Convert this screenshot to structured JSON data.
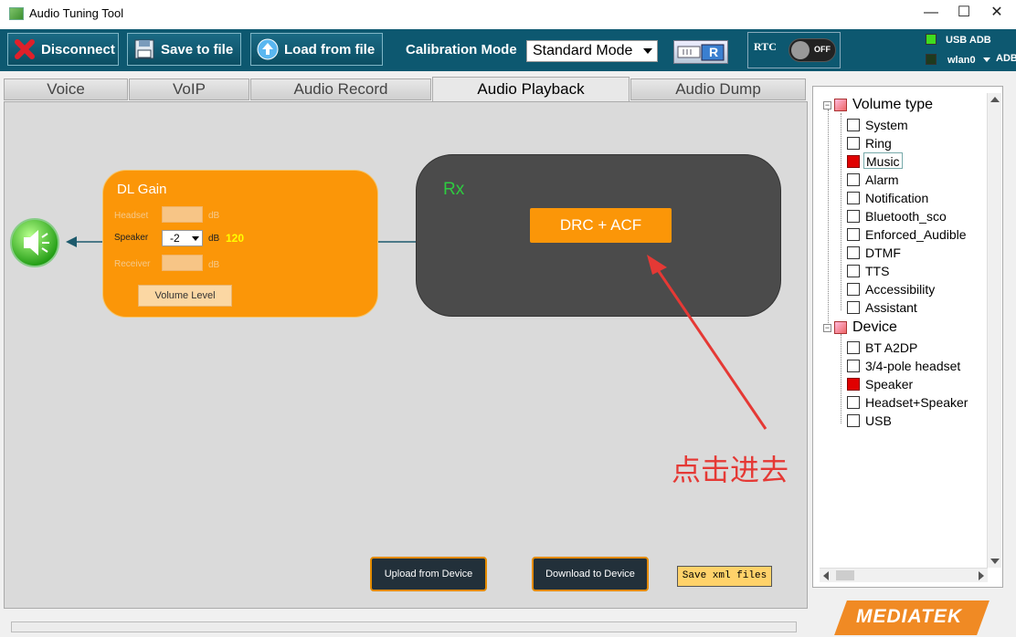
{
  "window": {
    "title": "Audio Tuning Tool",
    "minimize": "—",
    "maximize": "☐",
    "close": "✕"
  },
  "toolbar": {
    "disconnect": "Disconnect",
    "save_to_file": "Save to file",
    "load_from_file": "Load from file",
    "calibration_label": "Calibration Mode",
    "calibration_value": "Standard Mode",
    "r_button": "R",
    "rtc_label": "RTC",
    "rtc_toggle": "OFF",
    "usb_adb": "USB ADB",
    "wlan0": "wlan0",
    "adb": "ADB"
  },
  "tabs": [
    "Voice",
    "VoIP",
    "Audio Record",
    "Audio Playback",
    "Audio Dump"
  ],
  "active_tab": "Audio Playback",
  "dl_gain": {
    "title": "DL Gain",
    "headset_label": "Headset",
    "speaker_label": "Speaker",
    "receiver_label": "Receiver",
    "db": "dB",
    "speaker_value": "-2",
    "speaker_level": "120",
    "volume_level_button": "Volume Level"
  },
  "rx": {
    "title": "Rx",
    "drc_button": "DRC + ACF"
  },
  "annotation": "点击进去",
  "bottom_buttons": {
    "upload": "Upload from Device",
    "download": "Download to Device",
    "save_xml": "Save xml files"
  },
  "tree": {
    "volume_type_label": "Volume type",
    "volume_types": [
      {
        "label": "System",
        "checked": false
      },
      {
        "label": "Ring",
        "checked": false
      },
      {
        "label": "Music",
        "checked": true
      },
      {
        "label": "Alarm",
        "checked": false
      },
      {
        "label": "Notification",
        "checked": false
      },
      {
        "label": "Bluetooth_sco",
        "checked": false
      },
      {
        "label": "Enforced_Audible",
        "checked": false
      },
      {
        "label": "DTMF",
        "checked": false
      },
      {
        "label": "TTS",
        "checked": false
      },
      {
        "label": "Accessibility",
        "checked": false
      },
      {
        "label": "Assistant",
        "checked": false
      }
    ],
    "device_label": "Device",
    "devices": [
      {
        "label": "BT A2DP",
        "checked": false
      },
      {
        "label": "3/4-pole headset",
        "checked": false
      },
      {
        "label": "Speaker",
        "checked": true
      },
      {
        "label": "Headset+Speaker",
        "checked": false
      },
      {
        "label": "USB",
        "checked": false
      }
    ]
  },
  "brand": "MEDIATEK",
  "colors": {
    "toolbar_bg": "#0d5870",
    "orange": "#fb9608",
    "rx_bg": "#4b4b4b",
    "rx_title": "#2ecc40",
    "annotation": "#e53935",
    "checked_red": "#e00000"
  }
}
